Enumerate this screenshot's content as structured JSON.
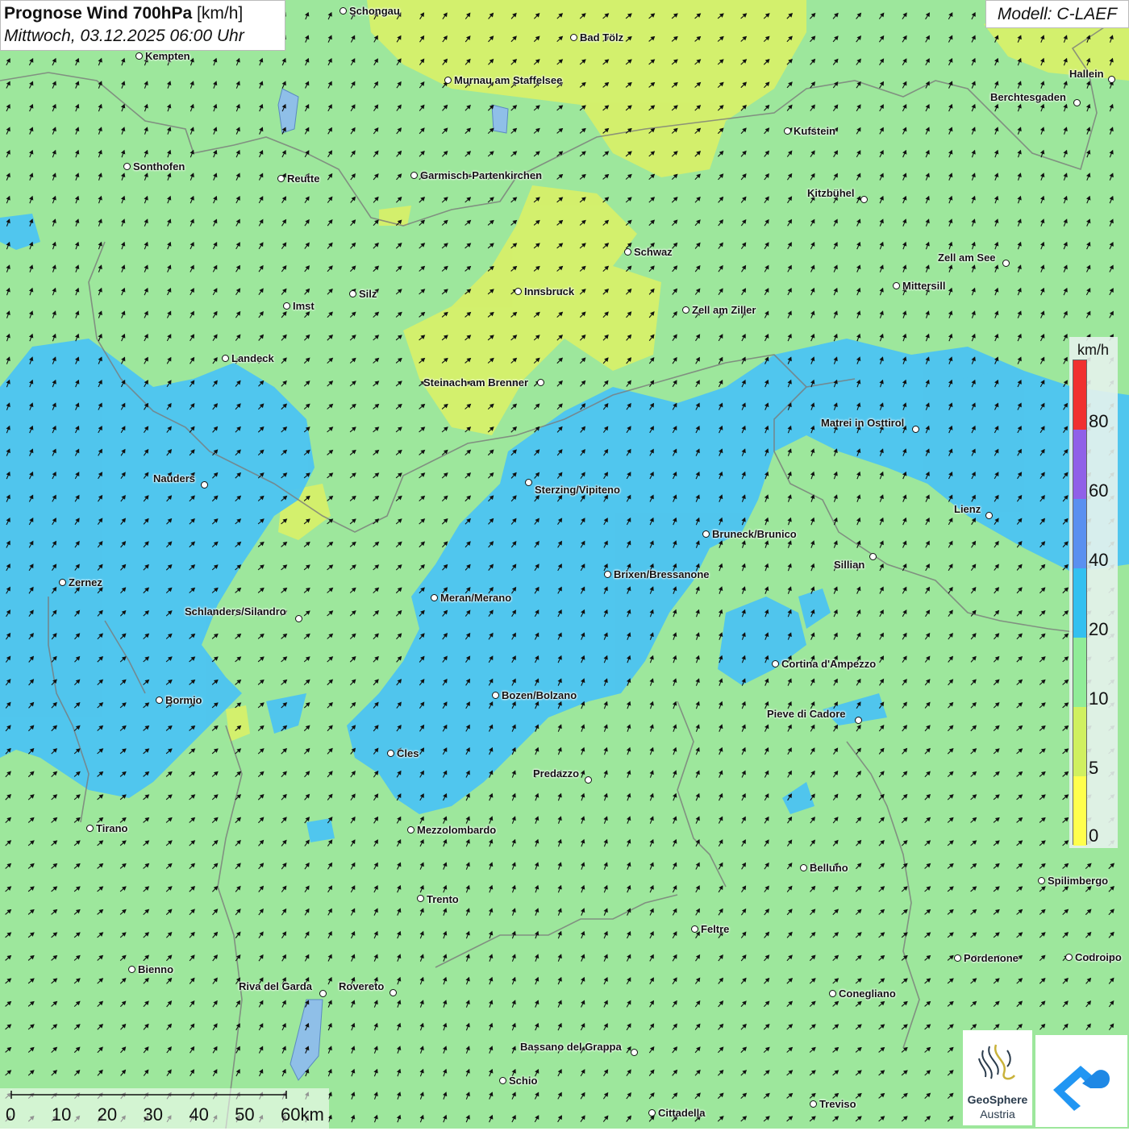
{
  "title": {
    "main": "Prognose Wind 700hPa",
    "unit": "[km/h]",
    "datetime": "Mittwoch, 03.12.2025 06:00 Uhr"
  },
  "model": "Modell: C-LAEF",
  "legend": {
    "unit": "km/h",
    "ticks": [
      "0",
      "5",
      "10",
      "20",
      "40",
      "60",
      "80"
    ],
    "classes": [
      {
        "from": 0,
        "to": 5,
        "color": "#ffff4d"
      },
      {
        "from": 5,
        "to": 10,
        "color": "#d0f060"
      },
      {
        "from": 10,
        "to": 20,
        "color": "#90ec98"
      },
      {
        "from": 20,
        "to": 40,
        "color": "#33c0f0"
      },
      {
        "from": 40,
        "to": 60,
        "color": "#5a90f0"
      },
      {
        "from": 60,
        "to": 80,
        "color": "#9060e8"
      },
      {
        "from": 80,
        "to": 100,
        "color": "#f03030"
      }
    ]
  },
  "scale": {
    "ticks": [
      "0",
      "10",
      "20",
      "30",
      "40",
      "50",
      "60km"
    ]
  },
  "logo": {
    "name": "GeoSphere",
    "sub": "Austria"
  },
  "places": [
    {
      "name": "Schongau"
    },
    {
      "name": "Bad Tölz"
    },
    {
      "name": "Kempten"
    },
    {
      "name": "Murnau am Staffelsee"
    },
    {
      "name": "Hallein"
    },
    {
      "name": "Berchtesgaden"
    },
    {
      "name": "Kufstein"
    },
    {
      "name": "Sonthofen"
    },
    {
      "name": "Reutte"
    },
    {
      "name": "Garmisch-Partenkirchen"
    },
    {
      "name": "Kitzbühel"
    },
    {
      "name": "Schwaz"
    },
    {
      "name": "Zell am See"
    },
    {
      "name": "Mittersill"
    },
    {
      "name": "Innsbruck"
    },
    {
      "name": "Silz"
    },
    {
      "name": "Imst"
    },
    {
      "name": "Zell am Ziller"
    },
    {
      "name": "Landeck"
    },
    {
      "name": "Steinach am Brenner"
    },
    {
      "name": "Matrei in Osttirol"
    },
    {
      "name": "Nauders"
    },
    {
      "name": "Sterzing/Vipiteno"
    },
    {
      "name": "Lienz"
    },
    {
      "name": "Bruneck/Brunico"
    },
    {
      "name": "Sillian"
    },
    {
      "name": "Brixen/Bressanone"
    },
    {
      "name": "Zernez"
    },
    {
      "name": "Meran/Merano"
    },
    {
      "name": "Schlanders/Silandro"
    },
    {
      "name": "Cortina d'Ampezzo"
    },
    {
      "name": "Bozen/Bolzano"
    },
    {
      "name": "Bormio"
    },
    {
      "name": "Pieve di Cadore"
    },
    {
      "name": "Cles"
    },
    {
      "name": "Predazzo"
    },
    {
      "name": "Tirano"
    },
    {
      "name": "Mezzolombardo"
    },
    {
      "name": "Belluno"
    },
    {
      "name": "Spilimbergo"
    },
    {
      "name": "Trento"
    },
    {
      "name": "Feltre"
    },
    {
      "name": "Bienno"
    },
    {
      "name": "Pordenone"
    },
    {
      "name": "Codroipo"
    },
    {
      "name": "Riva del Garda"
    },
    {
      "name": "Rovereto"
    },
    {
      "name": "Conegliano"
    },
    {
      "name": "Bassano del Grappa"
    },
    {
      "name": "Schio"
    },
    {
      "name": "Treviso"
    },
    {
      "name": "Cittadella"
    }
  ]
}
